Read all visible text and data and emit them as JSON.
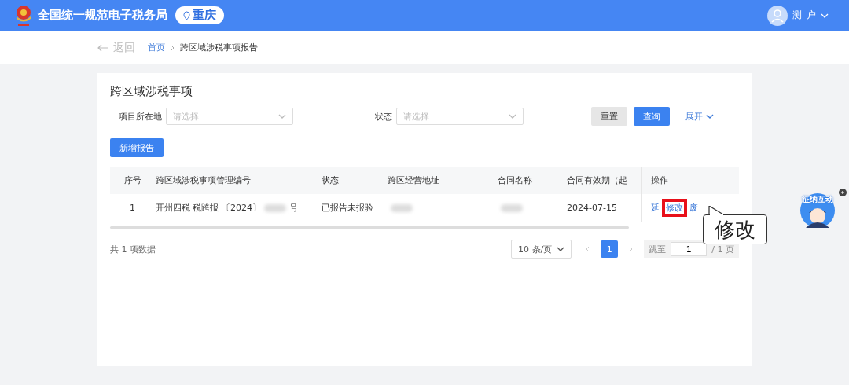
{
  "header": {
    "site_title": "全国统一规范电子税务局",
    "region": "重庆",
    "user": "测_户"
  },
  "breadcrumb": {
    "back": "返回",
    "items": [
      {
        "label": "首页",
        "link": true
      },
      {
        "label": "跨区域涉税事项报告",
        "link": false
      }
    ]
  },
  "panel": {
    "title": "跨区域涉税事项",
    "filters": [
      {
        "label": "项目所在地",
        "placeholder": "请选择"
      },
      {
        "label": "状态",
        "placeholder": "请选择"
      }
    ],
    "buttons": [
      {
        "label": "重置",
        "kind": "secondary"
      },
      {
        "label": "查询",
        "kind": "primary"
      },
      {
        "label": "展开",
        "kind": "link"
      }
    ],
    "add_button": "新增报告",
    "table": {
      "columns": [
        "序号",
        "跨区域涉税事项管理编号",
        "状态",
        "跨区经营地址",
        "合同名称",
        "合同有效期（起",
        "操作"
      ],
      "rows": [
        {
          "index": "1",
          "number_prefix": "开州四税 税跨报 〔2024〕",
          "number_redacted": true,
          "number_suffix": "号",
          "status": "已报告未报验",
          "address_redacted": true,
          "contract_redacted": true,
          "valid_from": "2024-07-15",
          "actions": [
            {
              "label": "延",
              "highlighted": false
            },
            {
              "label": "修改",
              "highlighted": true
            },
            {
              "label": "废",
              "highlighted": false
            }
          ]
        }
      ]
    },
    "total": "共 1 项数据",
    "pagination": {
      "page_size": "10 条/页",
      "pages": [
        {
          "label": "1",
          "selected": true
        }
      ],
      "jump_label": "跳至",
      "jump_value": "1",
      "page_total": "/ 1 页"
    }
  },
  "callout": "修改",
  "assistant": {
    "label": "征纳互动"
  }
}
